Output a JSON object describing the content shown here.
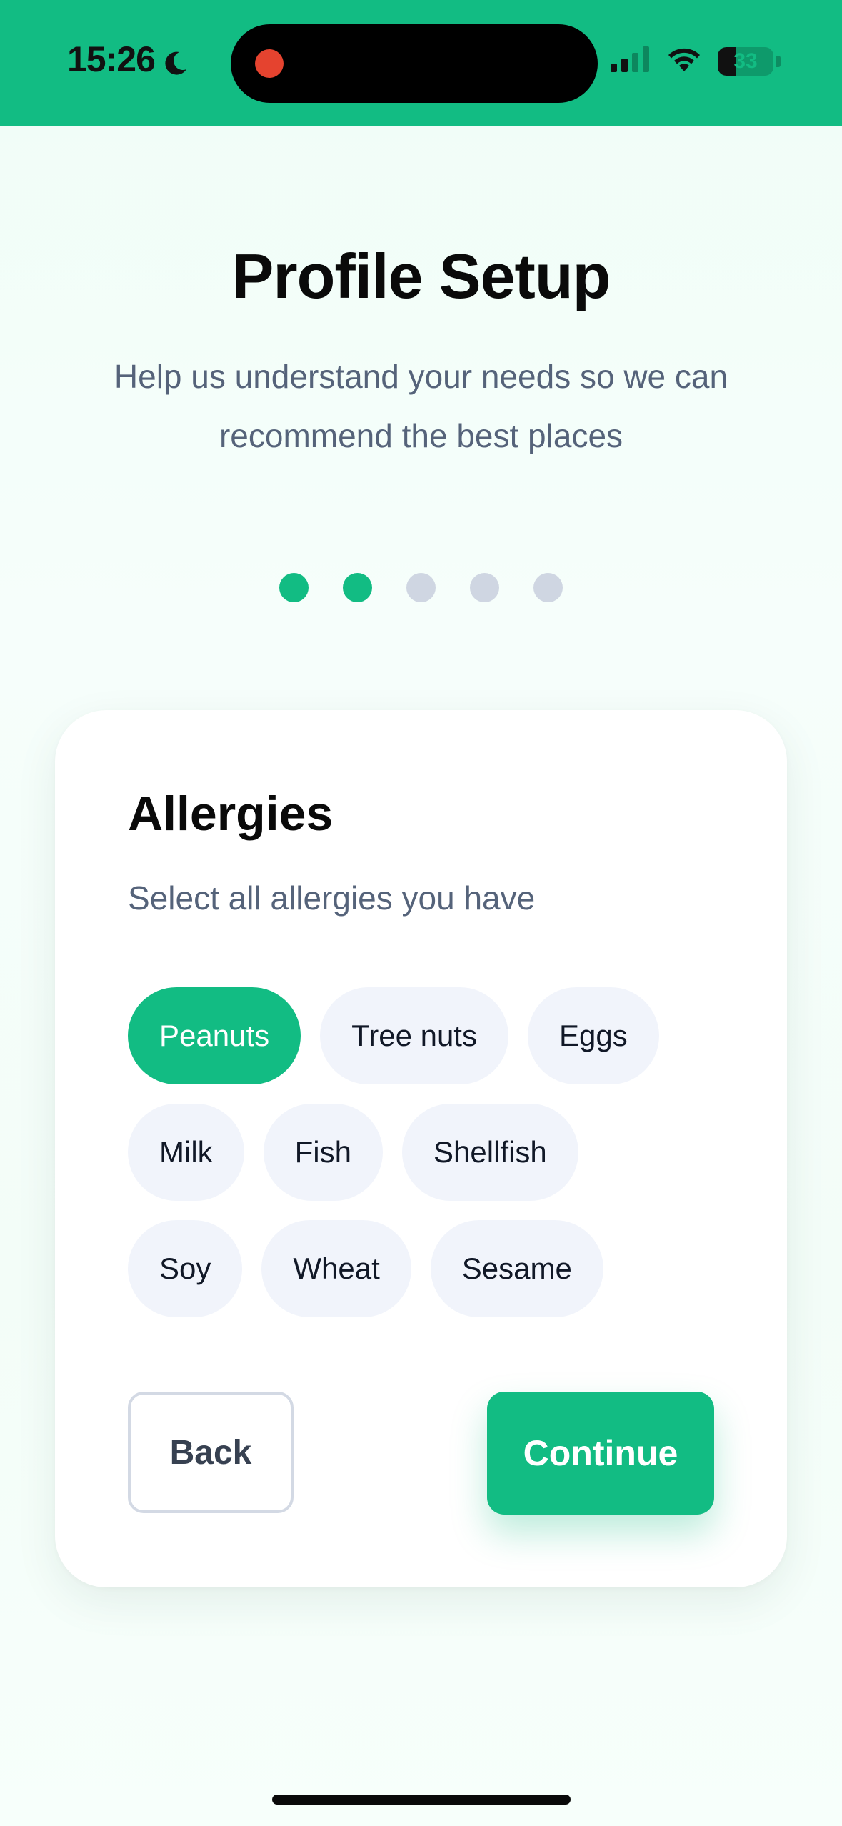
{
  "status_bar": {
    "time": "15:26",
    "battery_level": 33,
    "battery_label": "33",
    "icons": [
      "moon-icon",
      "record-indicator",
      "cellular-signal-icon",
      "wifi-icon",
      "battery-icon"
    ],
    "background_color": "#12bc83"
  },
  "header": {
    "title": "Profile Setup",
    "subtitle": "Help us understand your needs so we can recommend the best places"
  },
  "progress": {
    "total_steps": 5,
    "completed_steps": 2,
    "active_color": "#12bc83",
    "inactive_color": "#cfd6e2"
  },
  "card": {
    "title": "Allergies",
    "subtitle": "Select all allergies you have",
    "options": [
      {
        "label": "Peanuts",
        "selected": true
      },
      {
        "label": "Tree nuts",
        "selected": false
      },
      {
        "label": "Eggs",
        "selected": false
      },
      {
        "label": "Milk",
        "selected": false
      },
      {
        "label": "Fish",
        "selected": false
      },
      {
        "label": "Shellfish",
        "selected": false
      },
      {
        "label": "Soy",
        "selected": false
      },
      {
        "label": "Wheat",
        "selected": false
      },
      {
        "label": "Sesame",
        "selected": false
      }
    ],
    "back_label": "Back",
    "continue_label": "Continue"
  },
  "colors": {
    "accent": "#12bc83",
    "chip_background": "#f1f4fb",
    "text_primary": "#0a0a0a",
    "text_secondary": "#55637a"
  }
}
